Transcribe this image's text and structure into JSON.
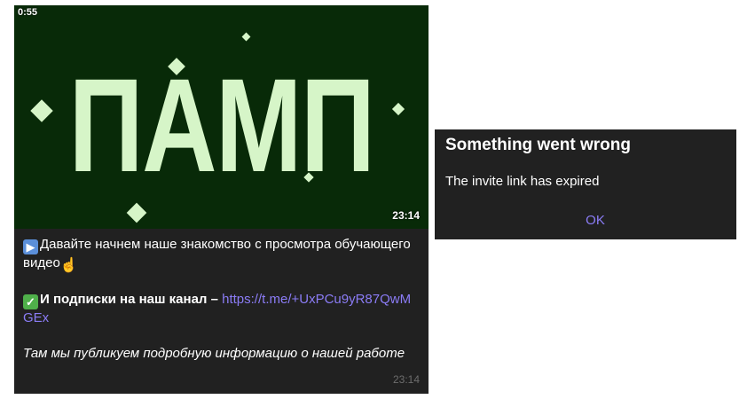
{
  "video": {
    "duration": "0:55",
    "overlay_text": "ПАМП",
    "time": "23:14"
  },
  "message": {
    "line1": "Давайте начнем наше знакомство с просмотра обучающего видео",
    "subscribe_label": "И подписки на наш канал – ",
    "link": "https://t.me/+UxPCu9yR87QwMGEx",
    "italic_text": "Там мы публикуем подробную информацию о нашей работе",
    "time": "23:14",
    "icons": [
      "film-icon",
      "check-icon",
      "pointing-hand-icon"
    ]
  },
  "dialog": {
    "title": "Something went wrong",
    "body": "The invite link has expired",
    "ok_label": "OK"
  },
  "colors": {
    "bubble_bg": "#212121",
    "link": "#8b7cf6",
    "video_bg": "#082a08",
    "video_text": "#d6f5c8"
  }
}
